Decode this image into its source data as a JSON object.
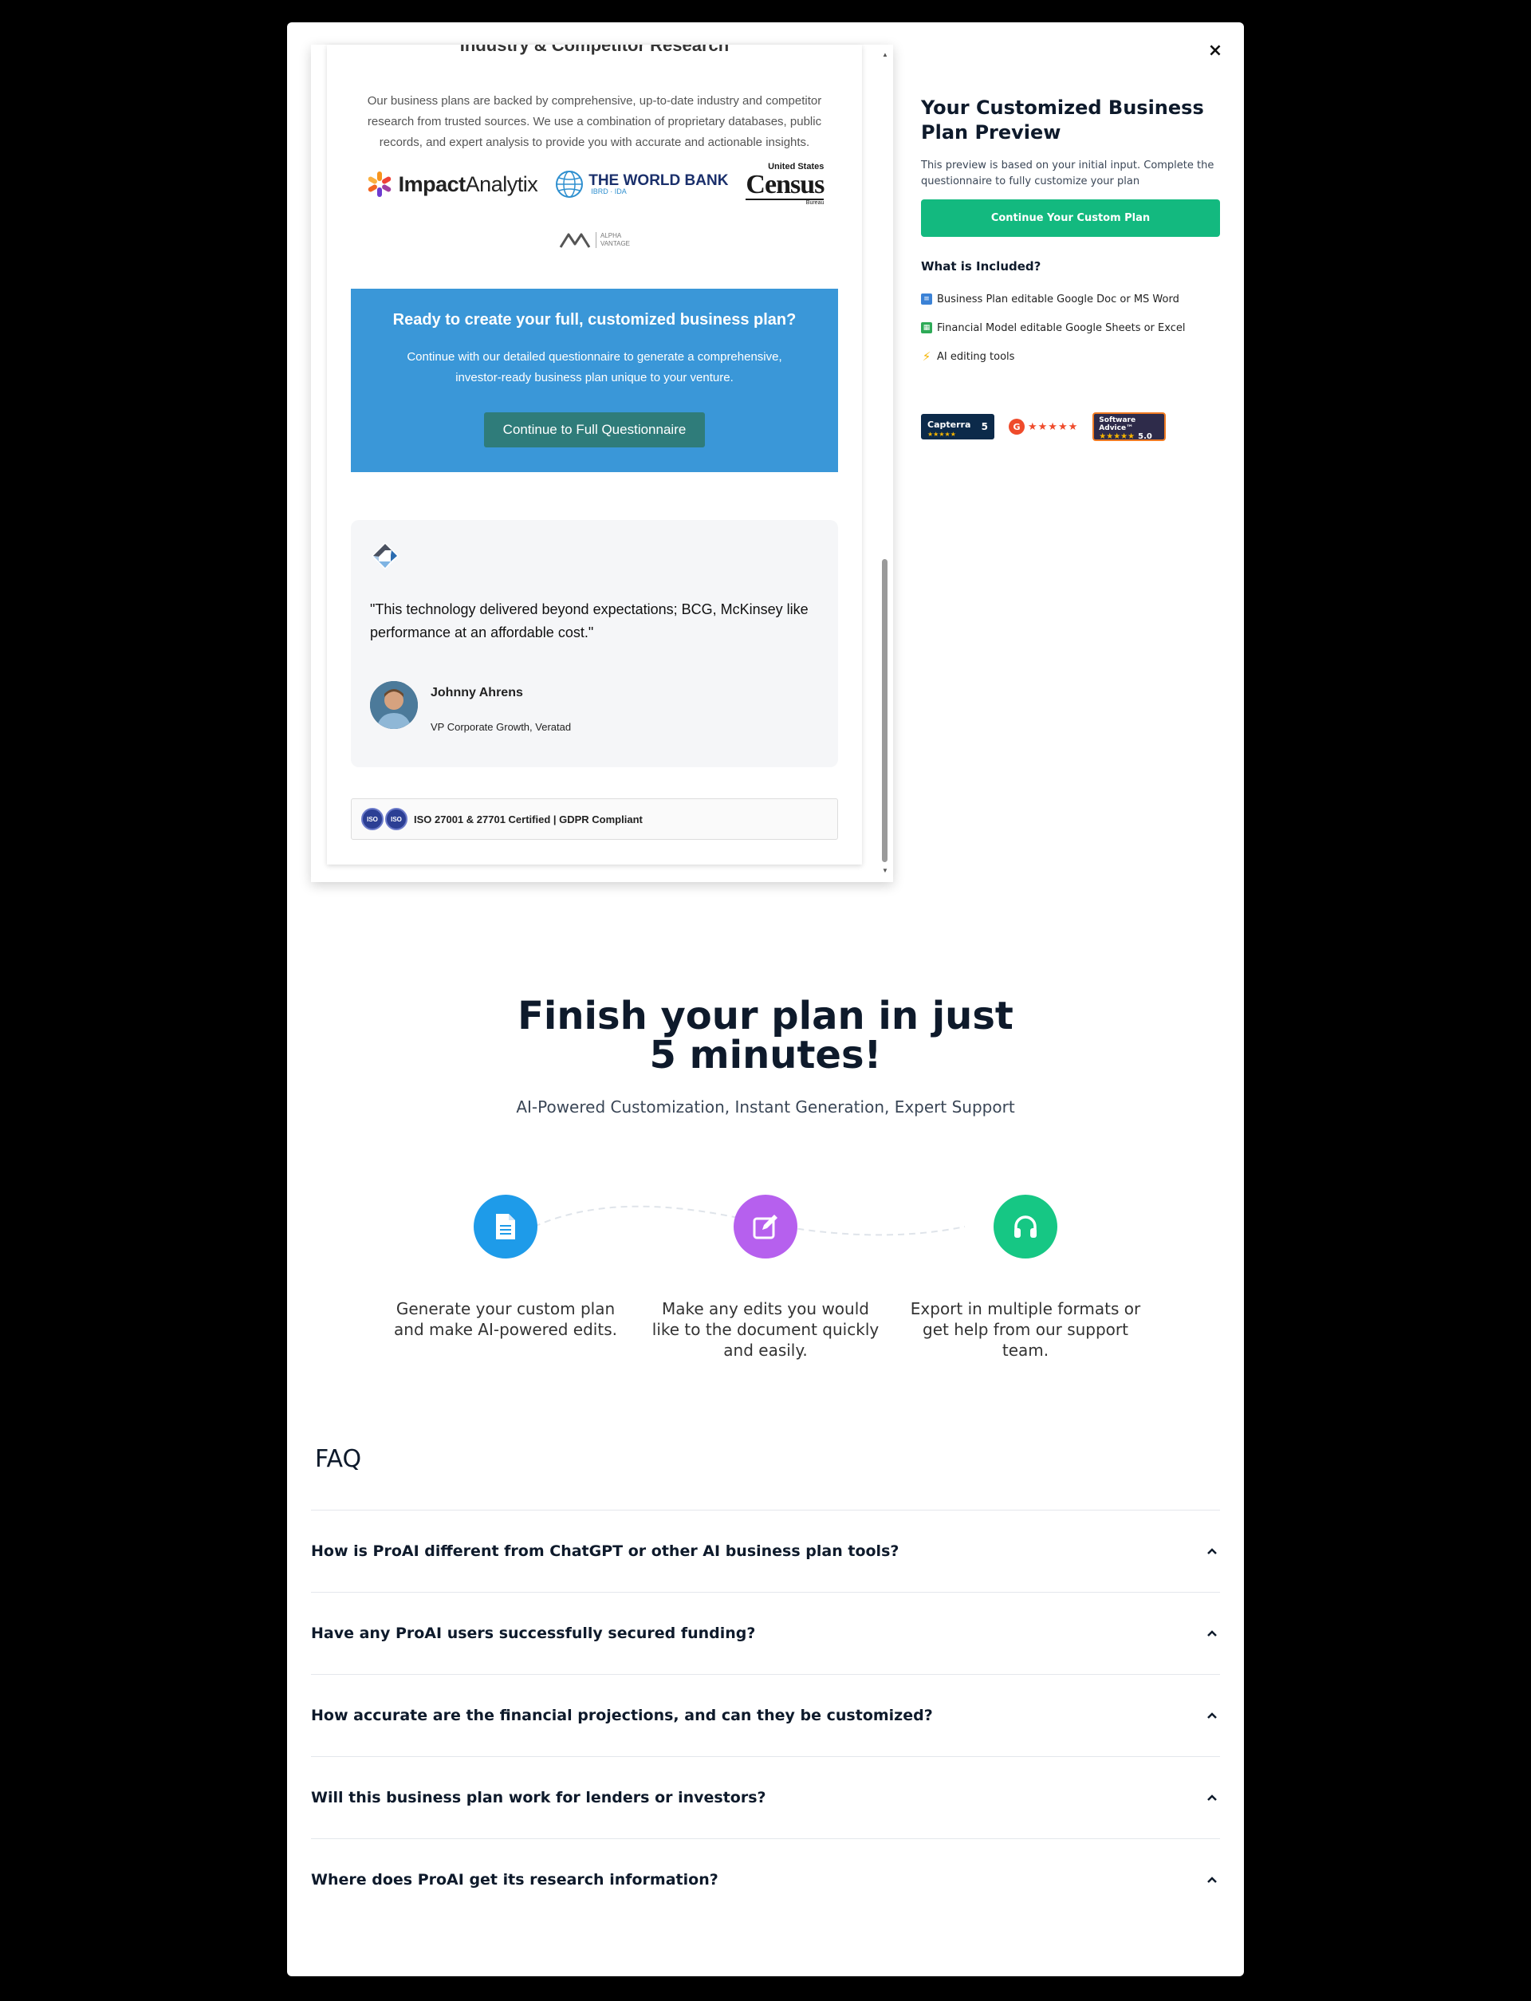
{
  "modal": {
    "close_label": "×"
  },
  "preview_doc": {
    "clipped_heading": "Industry & Competitor Research",
    "intro": "Our business plans are backed by comprehensive, up-to-date industry and competitor research from trusted sources. We use a combination of proprietary databases, public records, and expert analysis to provide you with accurate and actionable insights.",
    "logos": {
      "impact_bold": "Impact",
      "impact_light": "Analytix",
      "worldbank_main": "THE WORLD BANK",
      "worldbank_sub": "IBRD · IDA",
      "census_top": "United States",
      "census_big": "Census",
      "census_bottom": "Bureau",
      "alpha_line1": "ALPHA",
      "alpha_line2": "VANTAGE"
    },
    "cta": {
      "title": "Ready to create your full, customized business plan?",
      "description": "Continue with our detailed questionnaire to generate a comprehensive, investor-ready business plan unique to your venture.",
      "button": "Continue to Full Questionnaire"
    },
    "testimonial": {
      "quote": "\"This technology delivered beyond expectations; BCG, McKinsey like performance at an affordable cost.\"",
      "author": "Johnny Ahrens",
      "author_title": "VP Corporate Growth, Veratad"
    },
    "iso": {
      "badge1": "ISO",
      "badge2": "ISO",
      "text": "ISO 27001 & 27701 Certified | GDPR Compliant"
    }
  },
  "sidebar": {
    "title": "Your Customized Business Plan Preview",
    "description": "This preview is based on your initial input. Complete the questionnaire to fully customize your plan",
    "button": "Continue Your Custom Plan",
    "included_heading": "What is Included?",
    "included": [
      {
        "icon": "doc-icon",
        "label": "Business Plan editable Google Doc or MS Word"
      },
      {
        "icon": "sheet-icon",
        "label": "Financial Model editable Google Sheets or Excel"
      },
      {
        "icon": "bolt-icon",
        "label": "AI editing tools"
      }
    ],
    "badges": {
      "capterra_name": "Capterra",
      "capterra_score": "5",
      "capterra_stars": "★★★★★",
      "g2_logo": "G",
      "g2_stars": "★★★★★",
      "sa_name": "Software Advice™",
      "sa_stars": "★★★★★",
      "sa_score": "5.0"
    }
  },
  "finish": {
    "title_line1": "Finish your plan in just",
    "title_line2": "5 minutes!",
    "subtitle": "AI-Powered Customization, Instant Generation, Expert Support",
    "steps": [
      {
        "icon": "document-icon",
        "color": "#1e9be9",
        "text": "Generate your custom plan and make AI-powered edits."
      },
      {
        "icon": "edit-icon",
        "color": "#b660ee",
        "text": "Make any edits you would like to the document quickly and easily."
      },
      {
        "icon": "headphones-icon",
        "color": "#16c784",
        "text": "Export in multiple formats or get help from our support team."
      }
    ]
  },
  "faq": {
    "heading": "FAQ",
    "items": [
      "How is ProAI different from ChatGPT or other AI business plan tools?",
      "Have any ProAI users successfully secured funding?",
      "How accurate are the financial projections, and can they be customized?",
      "Will this business plan work for lenders or investors?",
      "Where does ProAI get its research information?"
    ]
  },
  "colors": {
    "accent_green": "#13b97f",
    "cta_blue": "#3a97d8",
    "cta_button": "#2f7c7a",
    "text_dark": "#0e1a2b"
  }
}
